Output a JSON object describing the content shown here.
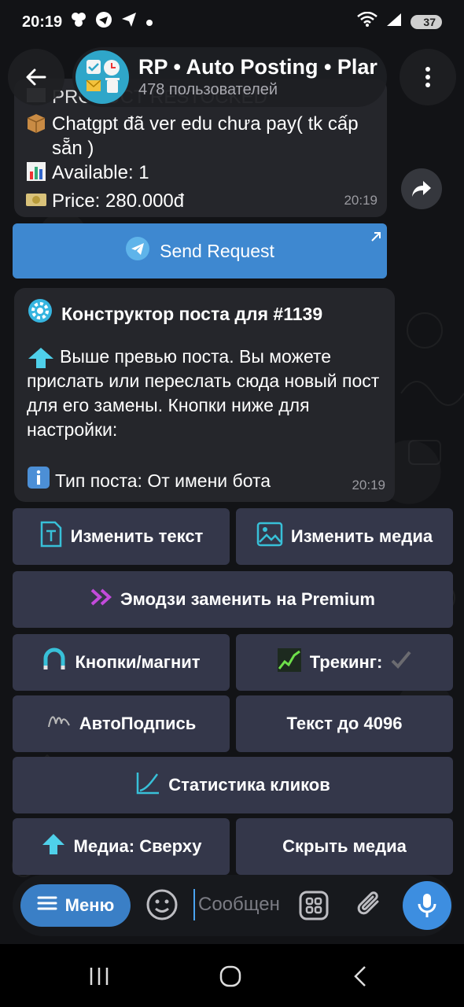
{
  "status_bar": {
    "time": "20:19",
    "battery": "37"
  },
  "header": {
    "title": "RP • Auto Posting • Plar",
    "subtitle": "478 пользователей"
  },
  "message1": {
    "partial_line": "PRODUCT RESTOCKED",
    "line1": "Chatgpt đã ver edu chưa pay( tk cấp sẵn )",
    "line2": "Available: 1",
    "line3": "Price: 280.000đ",
    "time": "20:19"
  },
  "send_request": {
    "label": "Send Request"
  },
  "message2": {
    "title": "Конструктор поста для #1139",
    "body": "Выше превью поста. Вы можете прислать или переслать сюда новый пост для его замены. Кнопки ниже для настройки:",
    "post_type": "Тип поста: От имени бота",
    "time": "20:19"
  },
  "keyboard": {
    "edit_text": "Изменить текст",
    "edit_media": "Изменить медиа",
    "premium_emoji": "Эмодзи заменить на Premium",
    "buttons_magnet": "Кнопки/магнит",
    "tracking": "Трекинг:",
    "auto_signature": "АвтоПодпись",
    "text_limit": "Текст до 4096",
    "click_stats": "Статистика кликов",
    "media_position": "Медиа: Сверху",
    "hide_media": "Скрыть медиа"
  },
  "input_bar": {
    "menu_label": "Меню",
    "placeholder": "Сообщение"
  },
  "colors": {
    "accent": "#3e88d0",
    "keyboard_button": "#34374a",
    "bubble": "#25262b"
  }
}
